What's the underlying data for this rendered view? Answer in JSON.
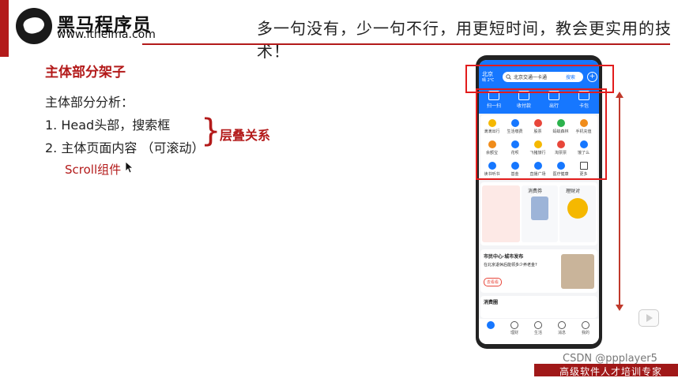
{
  "header": {
    "brand_cn": "黑马程序员",
    "brand_url": "www.itheima.com",
    "slogan": "多一句没有，少一句不行，用更短时间，教会更实用的技术！"
  },
  "slide": {
    "title": "主体部分架子",
    "subtitle": "主体部分分析：",
    "items": [
      "1.  Head头部，搜索框",
      "2.  主体页面内容 （可滚动）"
    ],
    "scroll_component": "Scroll组件",
    "stack_label": "层叠关系"
  },
  "phone": {
    "city": "北京",
    "weather": "晴 2℃",
    "search_text": "北京交通一卡通",
    "search_button": "搜索",
    "quick_actions": [
      "扫一扫",
      "收付款",
      "出行",
      "卡包"
    ],
    "grid": [
      "滴滴出行",
      "生活缴费",
      "股票",
      "蚂蚁森林",
      "手机充值",
      "余额宝",
      "花呗",
      "飞猪旅行",
      "淘票票",
      "饿了么",
      "读书听书",
      "基金",
      "直播广场",
      "医疗健康",
      "更多"
    ],
    "cards": [
      "消费券",
      "理财对"
    ],
    "news_title": "市民中心·城市发布",
    "news_text": "在北京退休后能领多少养老金?",
    "news_button": "去看看",
    "consume_title": "消费圈",
    "tabs": [
      "支",
      "理财",
      "生活",
      "消息",
      "我的"
    ]
  },
  "footer": {
    "watermark": "CSDN @ppplayer5",
    "tagline": "高级软件人才培训专家"
  },
  "colors": {
    "accent": "#b31a1a",
    "phone_blue": "#1677ff",
    "highlight": "#e21c1c"
  }
}
